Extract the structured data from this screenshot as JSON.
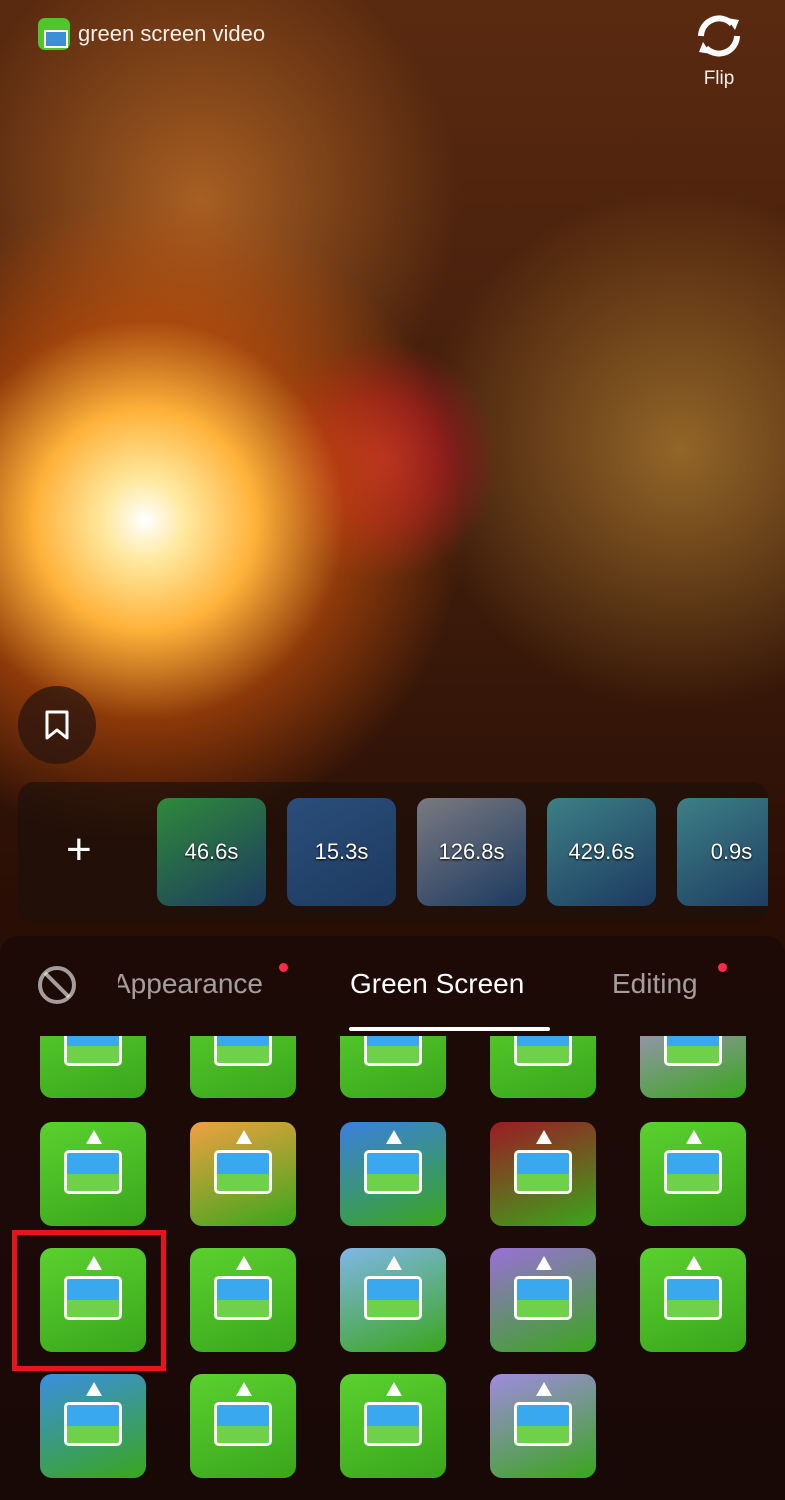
{
  "header": {
    "effect_name": "green screen video",
    "flip_label": "Flip"
  },
  "media_tray": {
    "add_label": "+",
    "clips": [
      {
        "duration": "46.6s",
        "color": "#2f8a3a"
      },
      {
        "duration": "15.3s",
        "color": "#2a4e7a"
      },
      {
        "duration": "126.8s",
        "color": "#7a7a80"
      },
      {
        "duration": "429.6s",
        "color": "#3d7f86"
      },
      {
        "duration": "0.9s",
        "color": "#3d7f86"
      }
    ]
  },
  "tabs": [
    {
      "label": "Appearance",
      "dot": true
    },
    {
      "label": "Green Screen",
      "active": true
    },
    {
      "label": "Editing",
      "dot": true
    }
  ],
  "effects": [
    {
      "name": "green-screen-photo",
      "bg": "#5ad12e"
    },
    {
      "name": "green-screen-split",
      "bg": "#5ad12e"
    },
    {
      "name": "green-screen-down",
      "bg": "#5ad12e"
    },
    {
      "name": "face-green-screen",
      "bg": "#5ad12e"
    },
    {
      "name": "purple-video",
      "bg": "#b58ee0"
    },
    {
      "name": "green-screen-face-shape",
      "bg": "#5ad12e"
    },
    {
      "name": "video-stack",
      "bg": "#f0a040"
    },
    {
      "name": "wave-silhouette",
      "bg": "#3a7fe0"
    },
    {
      "name": "red-frame",
      "bg": "#9c1b24"
    },
    {
      "name": "multi-frame-wave",
      "bg": "#5ad12e"
    },
    {
      "name": "green-screen-video",
      "bg": "#5ad12e",
      "selected": true
    },
    {
      "name": "photo-tilt-down",
      "bg": "#5ad12e"
    },
    {
      "name": "peace-sign-video",
      "bg": "#7fb6e8"
    },
    {
      "name": "eyes-photo",
      "bg": "#9a6fd8"
    },
    {
      "name": "thought-bubble-video",
      "bg": "#5ad12e"
    },
    {
      "name": "raise-hand-photo",
      "bg": "#3a8fe0"
    },
    {
      "name": "smiley-photo",
      "bg": "#5ad12e"
    },
    {
      "name": "multi-upload",
      "bg": "#5ad12e"
    },
    {
      "name": "heart-photo",
      "bg": "#a08ae0"
    }
  ]
}
